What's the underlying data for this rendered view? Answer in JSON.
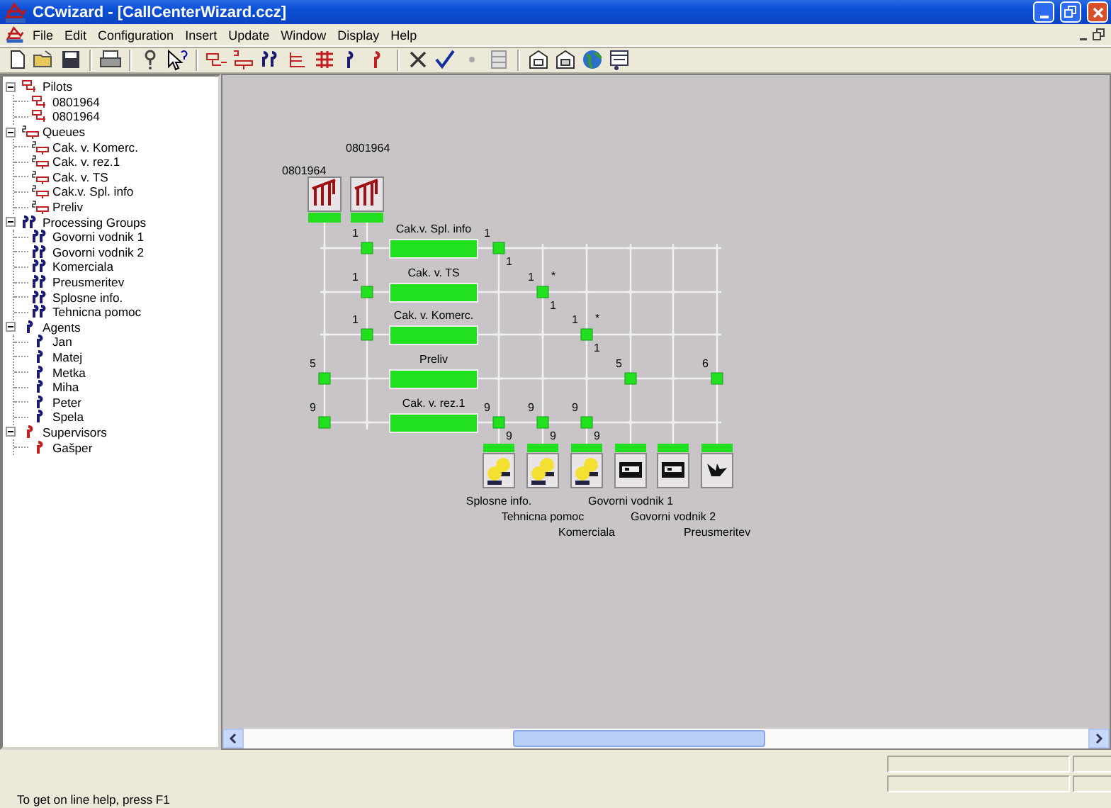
{
  "window": {
    "title": "CCwizard - [CallCenterWizard.ccz]"
  },
  "menu": [
    "File",
    "Edit",
    "Configuration",
    "Insert",
    "Update",
    "Window",
    "Display",
    "Help"
  ],
  "tree": [
    {
      "label": "Pilots",
      "kind": "pilot",
      "expanded": true,
      "children": [
        {
          "label": "0801964",
          "kind": "pilot"
        },
        {
          "label": "0801964",
          "kind": "pilot"
        }
      ]
    },
    {
      "label": "Queues",
      "kind": "queue",
      "expanded": true,
      "children": [
        {
          "label": "Cak. v. Komerc.",
          "kind": "queue"
        },
        {
          "label": "Cak. v. rez.1",
          "kind": "queue"
        },
        {
          "label": "Cak. v. TS",
          "kind": "queue"
        },
        {
          "label": "Cak.v. Spl. info",
          "kind": "queue"
        },
        {
          "label": "Preliv",
          "kind": "queue"
        }
      ]
    },
    {
      "label": "Processing Groups",
      "kind": "group",
      "expanded": true,
      "children": [
        {
          "label": "Govorni vodnik 1",
          "kind": "group"
        },
        {
          "label": "Govorni vodnik 2",
          "kind": "group"
        },
        {
          "label": "Komerciala",
          "kind": "group"
        },
        {
          "label": "Preusmeritev",
          "kind": "group"
        },
        {
          "label": "Splosne info.",
          "kind": "group"
        },
        {
          "label": "Tehnicna pomoc",
          "kind": "group"
        }
      ]
    },
    {
      "label": "Agents",
      "kind": "agent",
      "expanded": true,
      "children": [
        {
          "label": "Jan",
          "kind": "agent"
        },
        {
          "label": "Matej",
          "kind": "agent"
        },
        {
          "label": "Metka",
          "kind": "agent"
        },
        {
          "label": "Miha",
          "kind": "agent"
        },
        {
          "label": "Peter",
          "kind": "agent"
        },
        {
          "label": "Spela",
          "kind": "agent"
        }
      ]
    },
    {
      "label": "Supervisors",
      "kind": "supervisor",
      "expanded": true,
      "children": [
        {
          "label": "Gašper",
          "kind": "supervisor"
        }
      ]
    }
  ],
  "diagram": {
    "pilots": [
      {
        "label": "0801964"
      },
      {
        "label": "0801964"
      }
    ],
    "rows": [
      {
        "queue": "Cak.v. Spl. info",
        "cells": [
          {
            "linked": false
          },
          {
            "linked": true,
            "before": "1"
          },
          {
            "linked": true,
            "before": "1",
            "after": "1"
          },
          {
            "linked": false
          },
          {
            "linked": false
          },
          {
            "linked": false
          },
          {
            "linked": false
          },
          {
            "linked": false
          }
        ]
      },
      {
        "queue": "Cak. v. TS",
        "cells": [
          {
            "linked": false
          },
          {
            "linked": true,
            "before": "1"
          },
          {
            "linked": false
          },
          {
            "linked": true,
            "before": "1",
            "star": "*",
            "after": "1"
          },
          {
            "linked": false
          },
          {
            "linked": false
          },
          {
            "linked": false
          },
          {
            "linked": false
          }
        ]
      },
      {
        "queue": "Cak. v. Komerc.",
        "cells": [
          {
            "linked": false
          },
          {
            "linked": true,
            "before": "1"
          },
          {
            "linked": false
          },
          {
            "linked": false
          },
          {
            "linked": true,
            "before": "1",
            "star": "*",
            "after": "1"
          },
          {
            "linked": false
          },
          {
            "linked": false
          },
          {
            "linked": false
          }
        ]
      },
      {
        "queue": "Preliv",
        "cells": [
          {
            "linked": true,
            "before": "5"
          },
          {
            "linked": false
          },
          {
            "linked": false
          },
          {
            "linked": false
          },
          {
            "linked": false
          },
          {
            "linked": true,
            "before": "5"
          },
          {
            "linked": false
          },
          {
            "linked": true,
            "before": "6"
          }
        ]
      },
      {
        "queue": "Cak. v. rez.1",
        "cells": [
          {
            "linked": true,
            "before": "9"
          },
          {
            "linked": false
          },
          {
            "linked": true,
            "before": "9",
            "after": "9"
          },
          {
            "linked": true,
            "before": "9",
            "after": "9"
          },
          {
            "linked": true,
            "before": "9",
            "after": "9"
          },
          {
            "linked": false
          },
          {
            "linked": false
          },
          {
            "linked": false
          }
        ]
      }
    ],
    "groups": [
      {
        "label": "Splosne info.",
        "kind": "agents"
      },
      {
        "label": "Tehnicna pomoc",
        "kind": "agents"
      },
      {
        "label": "Komerciala",
        "kind": "agents"
      },
      {
        "label": "Govorni vodnik 1",
        "kind": "machine"
      },
      {
        "label": "Govorni vodnik 2",
        "kind": "machine"
      },
      {
        "label": "Preusmeritev",
        "kind": "redirect"
      }
    ]
  },
  "status_bar": {
    "text": "To get on line help, press F1"
  }
}
